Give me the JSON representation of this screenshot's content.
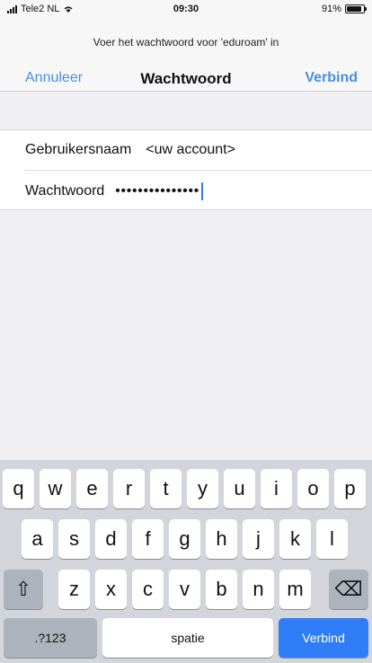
{
  "statusbar": {
    "carrier": "Tele2 NL",
    "time": "09:30",
    "battery_text": "91%",
    "battery_level": 0.91,
    "icons": [
      "signal-icon",
      "wifi-icon",
      "battery-icon"
    ]
  },
  "prompt": "Voer het wachtwoord voor 'eduroam' in",
  "navbar": {
    "cancel_label": "Annuleer",
    "title": "Wachtwoord",
    "join_label": "Verbind"
  },
  "form": {
    "username_label": "Gebruikersnaam",
    "username_value": "<uw account>",
    "password_label": "Wachtwoord",
    "password_value": "•••••••••••••••"
  },
  "keyboard": {
    "row1": [
      "q",
      "w",
      "e",
      "r",
      "t",
      "y",
      "u",
      "i",
      "o",
      "p"
    ],
    "row2": [
      "a",
      "s",
      "d",
      "f",
      "g",
      "h",
      "j",
      "k",
      "l"
    ],
    "row3": [
      "z",
      "x",
      "c",
      "v",
      "b",
      "n",
      "m"
    ],
    "shift_label": "⇧",
    "delete_label": "⌫",
    "numbers_label": ".?123",
    "space_label": "spatie",
    "join_label": "Verbind"
  },
  "colors": {
    "accent": "#4a90e2",
    "join_key": "#2f7df6"
  }
}
